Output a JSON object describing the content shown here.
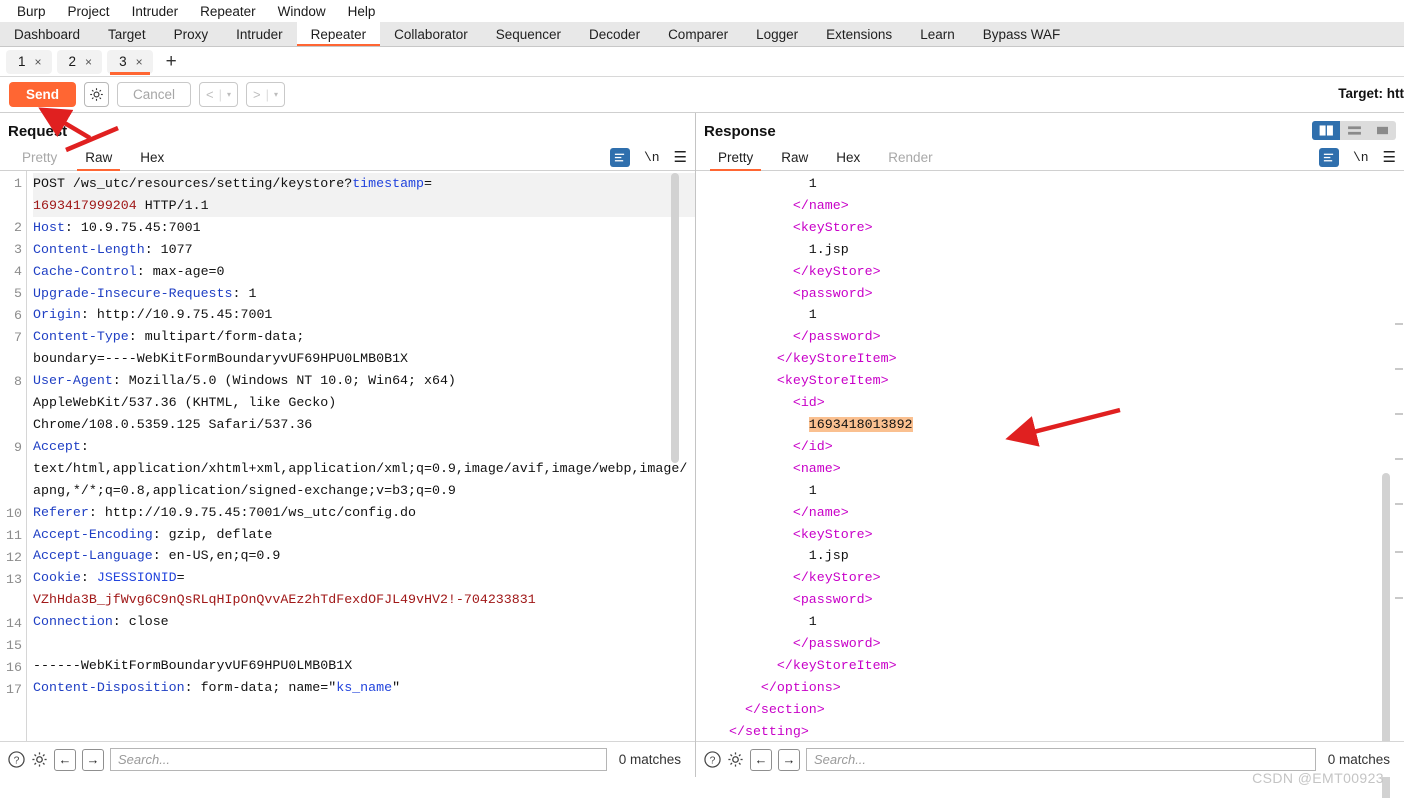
{
  "menu": {
    "items": [
      "Burp",
      "Project",
      "Intruder",
      "Repeater",
      "Window",
      "Help"
    ]
  },
  "main_tabs": {
    "items": [
      "Dashboard",
      "Target",
      "Proxy",
      "Intruder",
      "Repeater",
      "Collaborator",
      "Sequencer",
      "Decoder",
      "Comparer",
      "Logger",
      "Extensions",
      "Learn",
      "Bypass WAF"
    ],
    "active": "Repeater"
  },
  "repeater_tabs": {
    "items": [
      {
        "label": "1",
        "close": "×",
        "active": false
      },
      {
        "label": "2",
        "close": "×",
        "active": false
      },
      {
        "label": "3",
        "close": "×",
        "active": true
      }
    ],
    "add_label": "+"
  },
  "action_bar": {
    "send_label": "Send",
    "settings_icon": "gear-icon",
    "cancel_label": "Cancel",
    "prev_label": "<",
    "next_label": ">",
    "caret": "▾",
    "separator": "|",
    "target_label": "Target: htt"
  },
  "request": {
    "title": "Request",
    "tabs": [
      {
        "label": "Pretty",
        "active": false,
        "dim": true
      },
      {
        "label": "Raw",
        "active": true,
        "dim": false
      },
      {
        "label": "Hex",
        "active": false,
        "dim": false
      }
    ],
    "icons": [
      "format-icon",
      "newline-icon",
      "menu-icon"
    ],
    "newline_label": "\\n",
    "lines": [
      {
        "n": "1",
        "segments": [
          {
            "t": "POST /ws_utc/resources/setting/keystore?",
            "c": "val"
          },
          {
            "t": "timestamp",
            "c": "qp"
          },
          {
            "t": "=",
            "c": "val"
          },
          {
            "t": "\n",
            "c": "val"
          },
          {
            "t": "1693417999204",
            "c": "red"
          },
          {
            "t": " HTTP/1.1",
            "c": "val"
          }
        ]
      },
      {
        "n": "2",
        "segments": [
          {
            "t": "Host",
            "c": "hdr"
          },
          {
            "t": ": 10.9.75.45:7001",
            "c": "val"
          }
        ]
      },
      {
        "n": "3",
        "segments": [
          {
            "t": "Content-Length",
            "c": "hdr"
          },
          {
            "t": ": 1077",
            "c": "val"
          }
        ]
      },
      {
        "n": "4",
        "segments": [
          {
            "t": "Cache-Control",
            "c": "hdr"
          },
          {
            "t": ": max-age=0",
            "c": "val"
          }
        ]
      },
      {
        "n": "5",
        "segments": [
          {
            "t": "Upgrade-Insecure-Requests",
            "c": "hdr"
          },
          {
            "t": ": 1",
            "c": "val"
          }
        ]
      },
      {
        "n": "6",
        "segments": [
          {
            "t": "Origin",
            "c": "hdr"
          },
          {
            "t": ": http://10.9.75.45:7001",
            "c": "val"
          }
        ]
      },
      {
        "n": "7",
        "segments": [
          {
            "t": "Content-Type",
            "c": "hdr"
          },
          {
            "t": ": multipart/form-data;\nboundary=----WebKitFormBoundaryvUF69HPU0LMB0B1X",
            "c": "val"
          }
        ]
      },
      {
        "n": "8",
        "segments": [
          {
            "t": "User-Agent",
            "c": "hdr"
          },
          {
            "t": ": Mozilla/5.0 (Windows NT 10.0; Win64; x64)\nAppleWebKit/537.36 (KHTML, like Gecko)\nChrome/108.0.5359.125 Safari/537.36",
            "c": "val"
          }
        ]
      },
      {
        "n": "9",
        "segments": [
          {
            "t": "Accept",
            "c": "hdr"
          },
          {
            "t": ":\ntext/html,application/xhtml+xml,application/xml;q=0.9,image/avif,image/webp,image/apng,*/*;q=0.8,application/signed-exchange;v=b3;q=0.9",
            "c": "val"
          }
        ]
      },
      {
        "n": "10",
        "segments": [
          {
            "t": "Referer",
            "c": "hdr"
          },
          {
            "t": ": http://10.9.75.45:7001/ws_utc/config.do",
            "c": "val"
          }
        ]
      },
      {
        "n": "11",
        "segments": [
          {
            "t": "Accept-Encoding",
            "c": "hdr"
          },
          {
            "t": ": gzip, deflate",
            "c": "val"
          }
        ]
      },
      {
        "n": "12",
        "segments": [
          {
            "t": "Accept-Language",
            "c": "hdr"
          },
          {
            "t": ": en-US,en;q=0.9",
            "c": "val"
          }
        ]
      },
      {
        "n": "13",
        "segments": [
          {
            "t": "Cookie",
            "c": "hdr"
          },
          {
            "t": ": ",
            "c": "val"
          },
          {
            "t": "JSESSIONID",
            "c": "qp"
          },
          {
            "t": "=\n",
            "c": "val"
          },
          {
            "t": "VZhHda3B_jfWvg6C9nQsRLqHIpOnQvvAEz2hTdFexdOFJL49vHV2!-704233831",
            "c": "red"
          }
        ]
      },
      {
        "n": "14",
        "segments": [
          {
            "t": "Connection",
            "c": "hdr"
          },
          {
            "t": ": close",
            "c": "val"
          }
        ]
      },
      {
        "n": "15",
        "segments": [
          {
            "t": "",
            "c": "val"
          }
        ]
      },
      {
        "n": "16",
        "segments": [
          {
            "t": "------WebKitFormBoundaryvUF69HPU0LMB0B1X",
            "c": "val"
          }
        ]
      },
      {
        "n": "17",
        "segments": [
          {
            "t": "Content-Disposition",
            "c": "hdr"
          },
          {
            "t": ": form-data; name=\"",
            "c": "val"
          },
          {
            "t": "ks_name",
            "c": "qp"
          },
          {
            "t": "\"",
            "c": "val"
          }
        ]
      }
    ],
    "search": {
      "placeholder": "Search...",
      "matches": "0 matches",
      "help_icon": "help-icon",
      "settings_icon": "gear-icon",
      "prev_icon": "arrow-left-icon",
      "next_icon": "arrow-right-icon"
    }
  },
  "response": {
    "title": "Response",
    "tabs": [
      {
        "label": "Pretty",
        "active": true,
        "dim": false
      },
      {
        "label": "Raw",
        "active": false,
        "dim": false
      },
      {
        "label": "Hex",
        "active": false,
        "dim": false
      },
      {
        "label": "Render",
        "active": false,
        "dim": true
      }
    ],
    "layout_toggle": {
      "options": [
        "split-vertical-icon",
        "split-horizontal-icon",
        "single-pane-icon"
      ],
      "selected": 0
    },
    "icons": [
      "format-icon",
      "newline-icon",
      "menu-icon"
    ],
    "newline_label": "\\n",
    "highlight_color": "#fac090",
    "lines": [
      {
        "indent": 10,
        "segments": [
          {
            "t": "1",
            "c": "val"
          }
        ]
      },
      {
        "indent": 8,
        "segments": [
          {
            "t": "</",
            "c": "tag"
          },
          {
            "t": "name",
            "c": "tag"
          },
          {
            "t": ">",
            "c": "tag"
          }
        ]
      },
      {
        "indent": 8,
        "segments": [
          {
            "t": "<keyStore>",
            "c": "tag"
          }
        ]
      },
      {
        "indent": 10,
        "segments": [
          {
            "t": "1.jsp",
            "c": "val"
          }
        ]
      },
      {
        "indent": 8,
        "segments": [
          {
            "t": "</keyStore>",
            "c": "tag"
          }
        ]
      },
      {
        "indent": 8,
        "segments": [
          {
            "t": "<password>",
            "c": "tag"
          }
        ]
      },
      {
        "indent": 10,
        "segments": [
          {
            "t": "1",
            "c": "val"
          }
        ]
      },
      {
        "indent": 8,
        "segments": [
          {
            "t": "</password>",
            "c": "tag"
          }
        ]
      },
      {
        "indent": 6,
        "segments": [
          {
            "t": "</keyStoreItem>",
            "c": "tag"
          }
        ]
      },
      {
        "indent": 6,
        "segments": [
          {
            "t": "<keyStoreItem>",
            "c": "tag"
          }
        ]
      },
      {
        "indent": 8,
        "segments": [
          {
            "t": "<id>",
            "c": "tag"
          }
        ]
      },
      {
        "indent": 10,
        "segments": [
          {
            "t": "1693418013892",
            "c": "val",
            "hl": true
          }
        ]
      },
      {
        "indent": 8,
        "segments": [
          {
            "t": "</id>",
            "c": "tag"
          }
        ]
      },
      {
        "indent": 8,
        "segments": [
          {
            "t": "<name>",
            "c": "tag"
          }
        ]
      },
      {
        "indent": 10,
        "segments": [
          {
            "t": "1",
            "c": "val"
          }
        ]
      },
      {
        "indent": 8,
        "segments": [
          {
            "t": "</name>",
            "c": "tag"
          }
        ]
      },
      {
        "indent": 8,
        "segments": [
          {
            "t": "<keyStore>",
            "c": "tag"
          }
        ]
      },
      {
        "indent": 10,
        "segments": [
          {
            "t": "1.jsp",
            "c": "val"
          }
        ]
      },
      {
        "indent": 8,
        "segments": [
          {
            "t": "</keyStore>",
            "c": "tag"
          }
        ]
      },
      {
        "indent": 8,
        "segments": [
          {
            "t": "<password>",
            "c": "tag"
          }
        ]
      },
      {
        "indent": 10,
        "segments": [
          {
            "t": "1",
            "c": "val"
          }
        ]
      },
      {
        "indent": 8,
        "segments": [
          {
            "t": "</password>",
            "c": "tag"
          }
        ]
      },
      {
        "indent": 6,
        "segments": [
          {
            "t": "</keyStoreItem>",
            "c": "tag"
          }
        ]
      },
      {
        "indent": 4,
        "segments": [
          {
            "t": "</options>",
            "c": "tag"
          }
        ]
      },
      {
        "indent": 2,
        "segments": [
          {
            "t": "</section>",
            "c": "tag"
          }
        ]
      },
      {
        "indent": 0,
        "segments": [
          {
            "t": "</setting>",
            "c": "tag"
          }
        ]
      }
    ],
    "search": {
      "placeholder": "Search...",
      "matches": "0 matches",
      "help_icon": "help-icon",
      "settings_icon": "gear-icon",
      "prev_icon": "arrow-left-icon",
      "next_icon": "arrow-right-icon"
    }
  },
  "annotations": {
    "arrow_color": "#e02020",
    "arrows": [
      "send-button-arrow",
      "request-title-arrow",
      "highlighted-id-arrow"
    ]
  },
  "watermark": "CSDN @EMT00923"
}
